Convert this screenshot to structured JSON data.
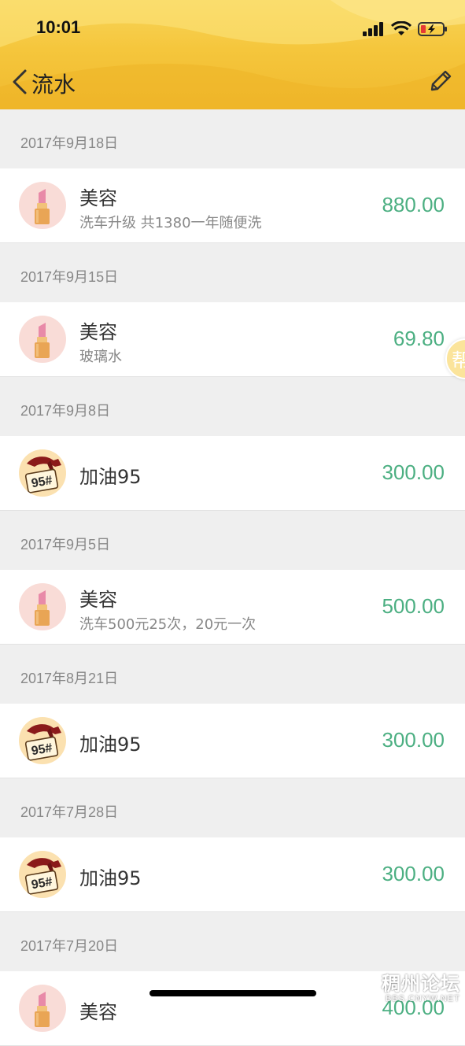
{
  "status_bar": {
    "time": "10:01"
  },
  "nav": {
    "title": "流水",
    "back_icon": "chevron-left-icon",
    "edit_icon": "pencil-icon"
  },
  "colors": {
    "header": "#f5c63c",
    "amount": "#4caf82",
    "page_bg": "#efefef"
  },
  "records": [
    {
      "date": "2017年9月18日",
      "icon": "lipstick-icon",
      "title": "美容",
      "note": "洗车升级 共1380一年随便洗",
      "amount": "880.00"
    },
    {
      "date": "2017年9月15日",
      "icon": "lipstick-icon",
      "title": "美容",
      "note": "玻璃水",
      "amount": "69.80"
    },
    {
      "date": "2017年9月8日",
      "icon": "fuel-nozzle-icon",
      "title": "加油95",
      "note": "",
      "amount": "300.00"
    },
    {
      "date": "2017年9月5日",
      "icon": "lipstick-icon",
      "title": "美容",
      "note": "洗车500元25次，20元一次",
      "amount": "500.00"
    },
    {
      "date": "2017年8月21日",
      "icon": "fuel-nozzle-icon",
      "title": "加油95",
      "note": "",
      "amount": "300.00"
    },
    {
      "date": "2017年7月28日",
      "icon": "fuel-nozzle-icon",
      "title": "加油95",
      "note": "",
      "amount": "300.00"
    },
    {
      "date": "2017年7月20日",
      "icon": "lipstick-icon",
      "title": "美容",
      "note": "",
      "amount": "400.00"
    }
  ],
  "fuel_badge_text": "95#",
  "float_button": {
    "label": "帮"
  },
  "watermark": {
    "main": "稠州论坛",
    "sub": "BBS.CNYW.NET"
  }
}
